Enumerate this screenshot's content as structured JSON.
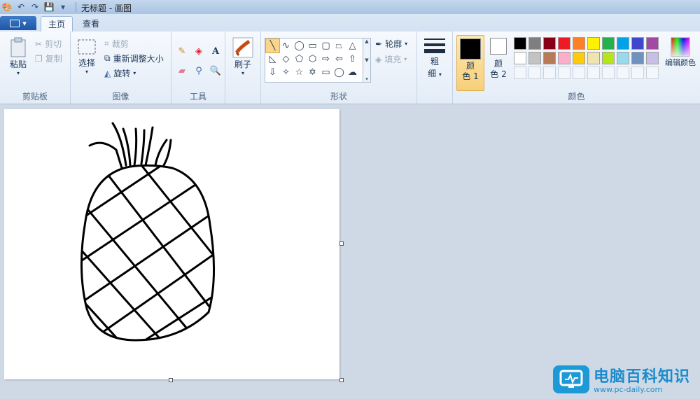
{
  "window": {
    "title": "无标题 - 画图"
  },
  "tabs": {
    "file": "▾",
    "home": "主页",
    "view": "查看"
  },
  "clipboard": {
    "paste": "粘贴",
    "cut": "剪切",
    "copy": "复制",
    "group": "剪贴板"
  },
  "image": {
    "select": "选择",
    "crop": "裁剪",
    "resize": "重新调整大小",
    "rotate": "旋转",
    "group": "图像"
  },
  "tools": {
    "group": "工具",
    "text_glyph": "A"
  },
  "brushes": {
    "label": "刷子"
  },
  "shapes": {
    "group": "形状",
    "outline": "轮廓",
    "fill": "填充"
  },
  "size": {
    "label_top": "粗",
    "label_bottom": "细"
  },
  "colors": {
    "group": "颜色",
    "color1_top": "颜",
    "color1_bottom": "色 1",
    "color2_top": "颜",
    "color2_bottom": "色 2",
    "edit": "编辑颜色",
    "color1": "#000000",
    "color2": "#ffffff",
    "palette": [
      "#000000",
      "#7f7f7f",
      "#880015",
      "#ed1c24",
      "#ff7f27",
      "#fff200",
      "#22b14c",
      "#00a2e8",
      "#3f48cc",
      "#a349a4",
      "#ffffff",
      "#c3c3c3",
      "#b97a57",
      "#ffaec9",
      "#ffc90e",
      "#efe4b0",
      "#b5e61d",
      "#99d9ea",
      "#7092be",
      "#c8bfe7",
      "",
      "",
      "",
      "",
      "",
      "",
      "",
      "",
      "",
      ""
    ]
  },
  "watermark": {
    "cn": "电脑百科知识",
    "en": "www.pc-daily.com"
  }
}
